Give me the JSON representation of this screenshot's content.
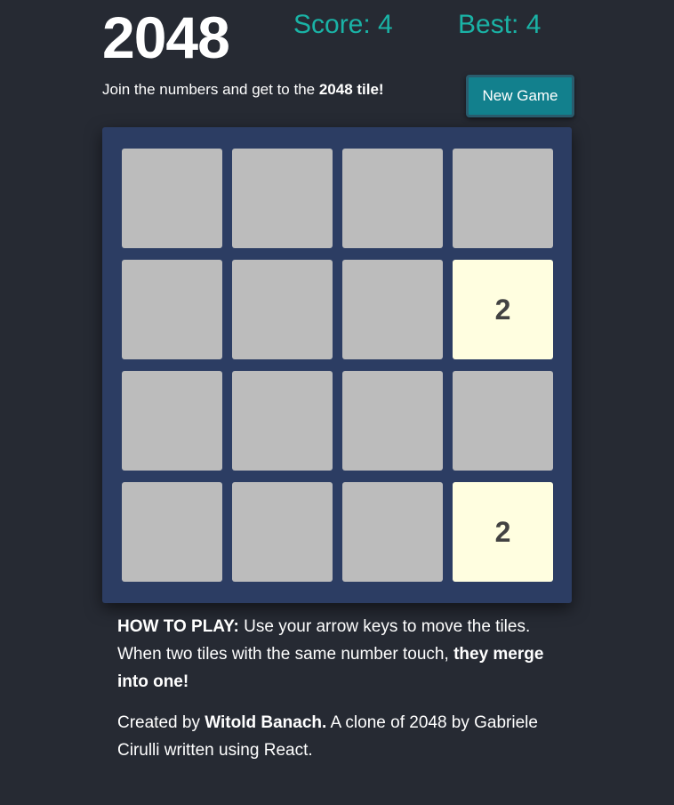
{
  "header": {
    "title": "2048",
    "score_text": "Score: 4",
    "best_text": "Best: 4"
  },
  "intro": {
    "text": "Join the numbers and get to the ",
    "strong": "2048 tile!"
  },
  "controls": {
    "new_game_label": "New Game"
  },
  "board": {
    "size": 4,
    "cells": [
      "",
      "",
      "",
      "",
      "",
      "",
      "",
      "2",
      "",
      "",
      "",
      "",
      "",
      "",
      "",
      "2"
    ]
  },
  "how_to_play": {
    "heading": "HOW TO PLAY:",
    "text": " Use your arrow keys to move the tiles. When two tiles with the same number touch, ",
    "strong": "they merge into one!"
  },
  "credits": {
    "prefix": "Created by ",
    "author": "Witold Banach.",
    "suffix": " A clone of 2048 by Gabriele Cirulli written using React."
  },
  "colors": {
    "background": "#262a33",
    "board": "#2c3d63",
    "empty_cell": "#bcbcbc",
    "tile_2": "#fffee0",
    "accent": "#1ab3a6",
    "button": "#12808d"
  }
}
